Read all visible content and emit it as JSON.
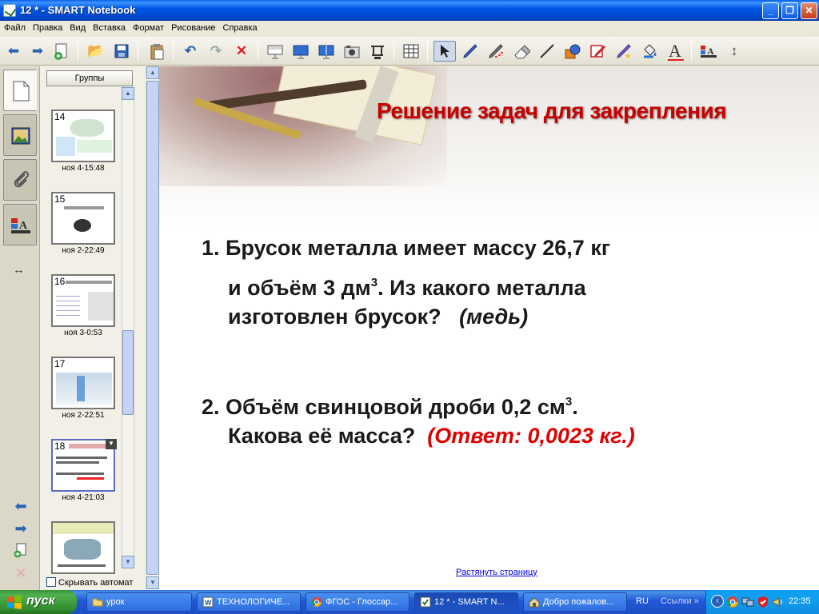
{
  "window": {
    "title": "12 * - SMART Notebook",
    "buttons": {
      "minimize": "_",
      "maximize": "❐",
      "close": "✕"
    }
  },
  "menu": [
    "Файл",
    "Правка",
    "Вид",
    "Вставка",
    "Формат",
    "Рисование",
    "Справка"
  ],
  "toolbar": {
    "icons": [
      "back-icon",
      "forward-icon",
      "add-page-icon",
      "open-icon",
      "save-icon",
      "paste-icon",
      "undo-icon",
      "redo-icon",
      "delete-icon",
      "screen-shade-icon",
      "full-screen-icon",
      "dual-view-icon",
      "capture-icon",
      "document-camera-icon",
      "table-icon",
      "select-icon",
      "pen-icon",
      "creative-pen-icon",
      "eraser-icon",
      "line-icon",
      "shapes-icon",
      "magic-pen-icon",
      "shape-recognition-pen-icon",
      "fill-icon",
      "text-icon",
      "properties-icon",
      "move-toolbar-icon"
    ]
  },
  "sorter": {
    "groups_label": "Группы",
    "thumbnails": [
      {
        "num": "14",
        "caption": "ноя 4-15:48"
      },
      {
        "num": "15",
        "caption": "ноя 2-22:49"
      },
      {
        "num": "16",
        "caption": "ноя 3-0:53"
      },
      {
        "num": "17",
        "caption": "ноя 2-22:51"
      },
      {
        "num": "18",
        "caption": "ноя 4-21:03"
      },
      {
        "num": "19",
        "caption": ""
      }
    ],
    "autohide_label": "Скрывать автомат"
  },
  "slide": {
    "title": "Решение задач для закрепления",
    "task1": {
      "line1": "1. Брусок металла имеет массу 26,7 кг",
      "line2a": "и объём 3 дм",
      "line2sup": "3",
      "line2b": ". Из какого металла",
      "line3": "изготовлен брусок?",
      "answer": "(медь)"
    },
    "task2": {
      "line1a": "2. Объём свинцовой дроби 0,2 см",
      "line1sup": "3",
      "line1b": ".",
      "line2": "Какова её масса?",
      "answer": "(Ответ: 0,0023 кг.)"
    },
    "stretch_link": "Растянуть страницу"
  },
  "taskbar": {
    "start_label": "пуск",
    "items": [
      {
        "label": "урок",
        "icon": "folder-icon"
      },
      {
        "label": "ТЕХНОЛОГИЧЕ...",
        "icon": "word-icon"
      },
      {
        "label": "ФГОС - Глоссар...",
        "icon": "chrome-icon"
      },
      {
        "label": "12 * - SMART N...",
        "icon": "smart-notebook-icon"
      },
      {
        "label": "Добро пожалов...",
        "icon": "home-icon"
      }
    ],
    "language": "RU",
    "links_label": "Ссылки",
    "clock": "22:35"
  }
}
